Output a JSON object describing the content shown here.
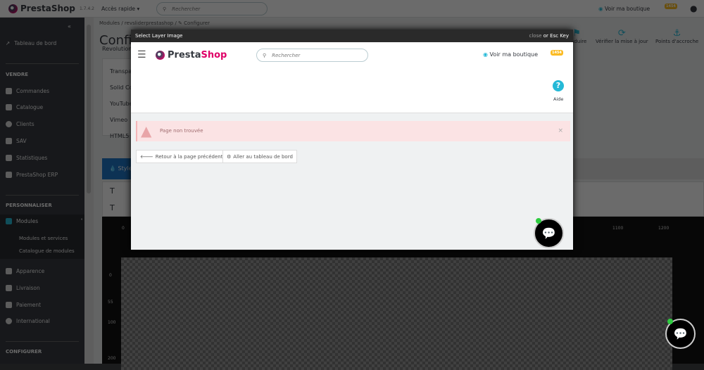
{
  "topbar": {
    "logo": "PrestaShop",
    "version": "1.7.4.2",
    "quick_access": "Accès rapide",
    "search_placeholder": "Rechercher",
    "view_shop": "Voir ma boutique",
    "notif_count": "1454"
  },
  "sidebar": {
    "dashboard": "Tableau de bord",
    "sections": [
      "VENDRE",
      "PERSONNALISER",
      "CONFIGURER"
    ],
    "sell_items": [
      "Commandes",
      "Catalogue",
      "Clients",
      "SAV",
      "Statistiques",
      "PrestaShop ERP"
    ],
    "modules": "Modules",
    "module_sub": [
      "Modules et services",
      "Catalogue de modules"
    ],
    "custom_items": [
      "Apparence",
      "Livraison",
      "Paiement",
      "International"
    ]
  },
  "main": {
    "breadcrumb": [
      "Modules",
      "revsliderprestashop",
      "Configurer"
    ],
    "title": "Configurer",
    "subtitle": "Revolution",
    "toolbar": [
      "Traduire",
      "Vérifier la mise à jour",
      "Points d'accroche"
    ],
    "bg_types": [
      "Transparent",
      "Solid Color",
      "YouTube",
      "Vimeo",
      "HTML5"
    ],
    "style_tab": "Style",
    "ruler_x": [
      "0",
      "1100",
      "1200"
    ],
    "ruler_y": [
      "0",
      "55",
      "100",
      "200"
    ]
  },
  "modal": {
    "title": "Select Layer Image",
    "close": "close",
    "close_key": "or Esc Key",
    "logo": "PrestaShop",
    "search_placeholder": "Rechercher",
    "view_shop": "Voir ma boutique",
    "notif_count": "1454",
    "help": "Aide",
    "alert": "Page non trouvée",
    "alert_close": "×",
    "back_button": "Retour à la page précédente",
    "dashboard_button": "Aller au tableau de bord"
  }
}
